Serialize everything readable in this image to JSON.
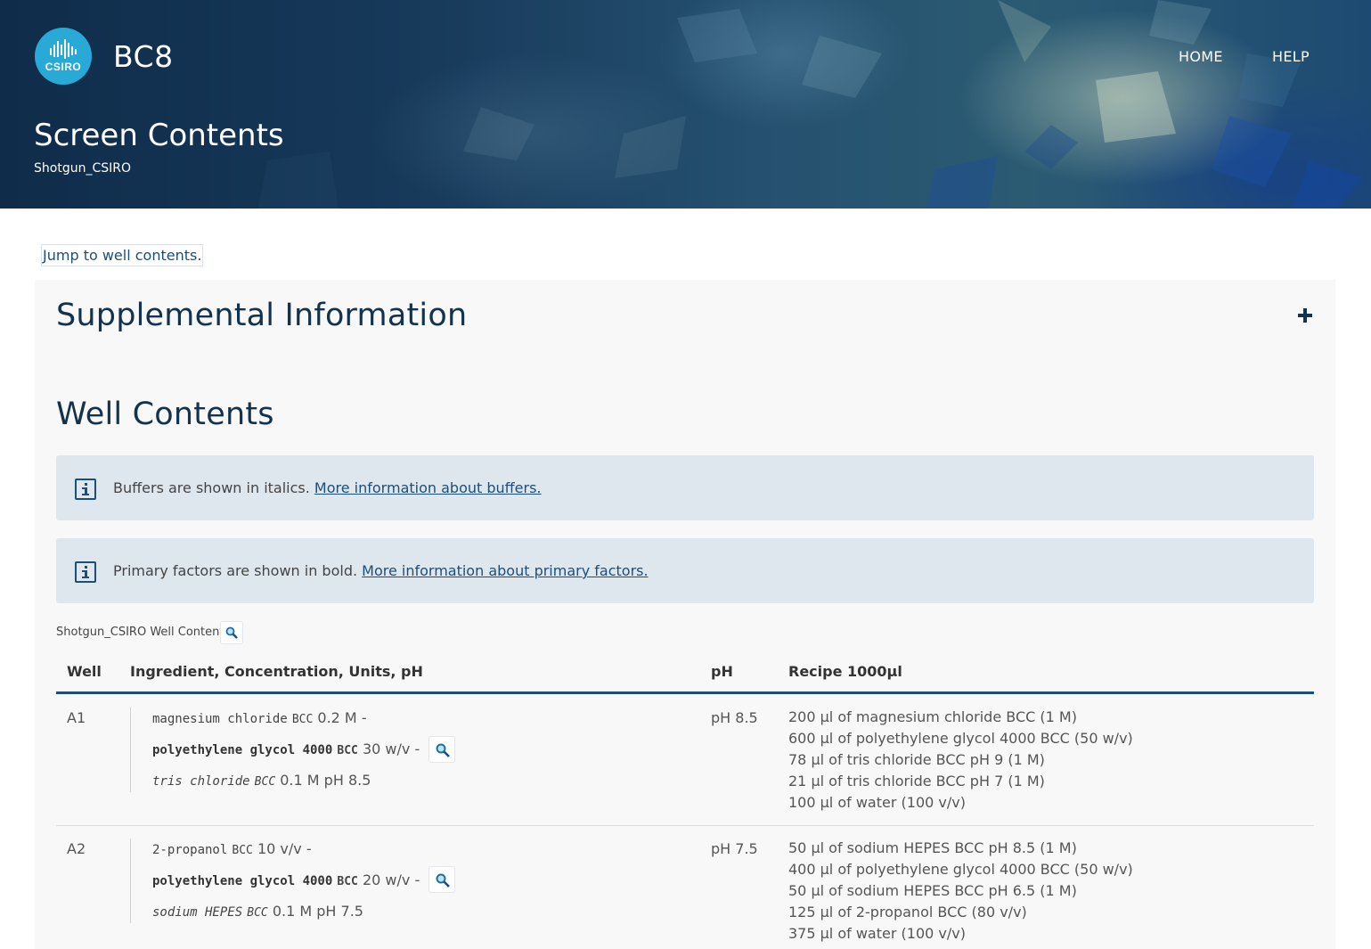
{
  "header": {
    "logo_text": "CSIRO",
    "app_title": "BC8",
    "nav": [
      {
        "label": "HOME"
      },
      {
        "label": "HELP"
      }
    ],
    "page_title": "Screen Contents",
    "page_subtitle": "Shotgun_CSIRO"
  },
  "jump_link": "Jump to well contents.",
  "supplemental": {
    "title": "Supplemental Information",
    "toggle_icon": "plus-icon"
  },
  "well_contents": {
    "title": "Well Contents",
    "notes": [
      {
        "text": "Buffers are shown in italics. ",
        "link": "More information about buffers."
      },
      {
        "text": "Primary factors are shown in bold. ",
        "link": "More information about primary factors."
      }
    ],
    "table_caption": "Shotgun_CSIRO Well Contents",
    "columns": [
      "Well",
      "Ingredient, Concentration, Units, pH",
      "pH",
      "Recipe 1000µl"
    ],
    "rows": [
      {
        "well": "A1",
        "ingredients": [
          {
            "name": "magnesium chloride",
            "tag": "BCC",
            "amount": "0.2 M -",
            "style": "normal"
          },
          {
            "name": "polyethylene glycol 4000",
            "tag": "BCC",
            "amount": "30 w/v -",
            "style": "bold"
          },
          {
            "name": "tris chloride",
            "tag": "BCC",
            "amount": "0.1 M pH 8.5",
            "style": "italic"
          }
        ],
        "ph": "pH 8.5",
        "recipe": [
          "200 µl of magnesium chloride BCC (1 M)",
          "600 µl of polyethylene glycol 4000 BCC (50 w/v)",
          "78 µl of tris chloride BCC pH 9 (1 M)",
          "21 µl of tris chloride BCC pH 7 (1 M)",
          "100 µl of water (100 v/v)"
        ]
      },
      {
        "well": "A2",
        "ingredients": [
          {
            "name": "2-propanol",
            "tag": "BCC",
            "amount": "10 v/v -",
            "style": "normal"
          },
          {
            "name": "polyethylene glycol 4000",
            "tag": "BCC",
            "amount": "20 w/v -",
            "style": "bold"
          },
          {
            "name": "sodium HEPES",
            "tag": "BCC",
            "amount": "0.1 M pH 7.5",
            "style": "italic"
          }
        ],
        "ph": "pH 7.5",
        "recipe": [
          "50 µl of sodium HEPES BCC pH 8.5 (1 M)",
          "400 µl of polyethylene glycol 4000 BCC (50 w/v)",
          "50 µl of sodium HEPES BCC pH 6.5 (1 M)",
          "125 µl of 2-propanol BCC (80 v/v)",
          "375 µl of water (100 v/v)"
        ]
      }
    ]
  },
  "colors": {
    "brand": "#29a9d6",
    "accent": "#1d4e79",
    "heading": "#12324d",
    "note_bg": "#dfe7ee"
  }
}
